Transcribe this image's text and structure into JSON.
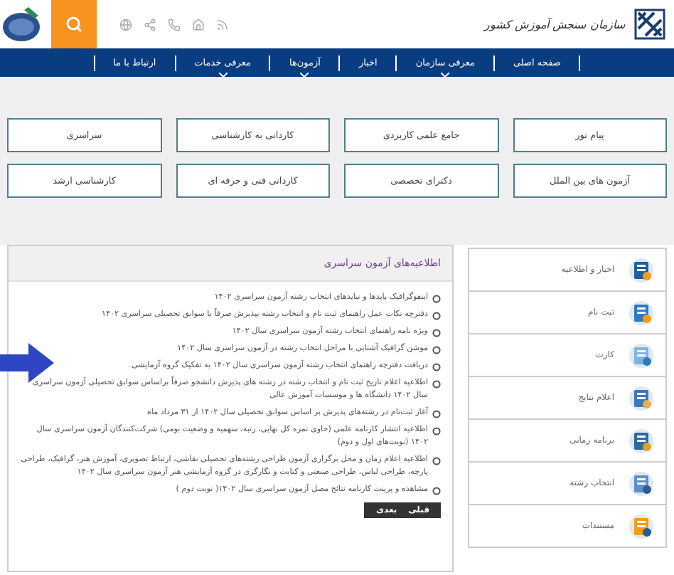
{
  "header": {
    "logo_text": "سازمان سنجش آموزش کشور"
  },
  "nav": [
    {
      "label": "صفحه اصلی",
      "has_submenu": false
    },
    {
      "label": "معرفی سازمان",
      "has_submenu": true
    },
    {
      "label": "اخبار",
      "has_submenu": false
    },
    {
      "label": "آزمون‌ها",
      "has_submenu": true
    },
    {
      "label": "معرفی خدمات",
      "has_submenu": true
    },
    {
      "label": "ارتباط با ما",
      "has_submenu": false
    }
  ],
  "exam_links": [
    "پیام نور",
    "جامع علمی کاربردی",
    "کاردانی به کارشناسی",
    "سراسری",
    "آزمون های بین الملل",
    "دکترای تخصصی",
    "کاردانی فنی و حرفه ای",
    "کارشناسی ارشد"
  ],
  "sidebar": [
    {
      "label": "اخبار و اطلاعیه",
      "kind": "news"
    },
    {
      "label": "ثبت نام",
      "kind": "register"
    },
    {
      "label": "کارت",
      "kind": "card"
    },
    {
      "label": "اعلام نتایج",
      "kind": "results"
    },
    {
      "label": "برنامه زمانی",
      "kind": "schedule"
    },
    {
      "label": "انتخاب رشته",
      "kind": "choice"
    },
    {
      "label": "مستندات",
      "kind": "docs"
    }
  ],
  "announcements": {
    "title": "اطلاعیه‌های آزمون سراسری",
    "items": [
      "اینفوگرافیک بایدها و نبایدهای انتخاب رشته آزمون سراسری ۱۴۰۲",
      "دفترچه نکات عمل راهنمای ثبت نام و انتخاب رشته بپذیرش صرفاً با سوابق تحصیلی سراسری ۱۴۰۲",
      "ویژه نامه راهنمای انتخاب رشته آزمون سراسری سال ۱۴۰۲",
      "موشن گرافیک آشنایی با مراحل انتخاب رشته در آزمون سراسری سال ۱۴۰۲",
      "دریافت دفترچه راهنمای انتخاب رشته آزمون سراسری سال ۱۴۰۲ به تفکیک گروه آزمایشی",
      "اطلاعیه اعلام تاریخ ثبت نام و انتخاب رشته در رشته های پذیرش دانشجو صرفاً براساس سوابق تحصیلی آزمون سراسری سال ۱۴۰۲ دانشگاه ها و موسسات آموزش عالی",
      "آغاز ثبت‌نام در رشته‌های پذیرش بر اساس سوابق تحصیلی سال ۱۴۰۲ از ۳۱ مرداد ماه",
      "اطلاعیه انتشار کارنامه علمی (حاوی نمره کل نهایی، رتبه، سهمیه و وضعیت بومی) شرکت‌کنندگان آزمون سراسری سال ۱۴۰۲ (نوبت‌های اول و دوم)",
      "اطلاعیه اعلام زمان و محل برگزاری آزمون طراحی رشته‌های تحصیلی نقاشی، ارتباط تصویری، آموزش هنر، گرافیک، طراحی پارچه، طراحی لباس، طراحی صنعتی و کتابت و نگارگری در گروه آزمایشی هنر آزمون سراسری سال ۱۴۰۲",
      "مشاهده و پرینت کارنامه نتائج مصل آزمون سراسری سال ۱۴۰۲( نوبت دوم )"
    ],
    "pager": [
      "قبلی",
      "بعدی"
    ]
  }
}
